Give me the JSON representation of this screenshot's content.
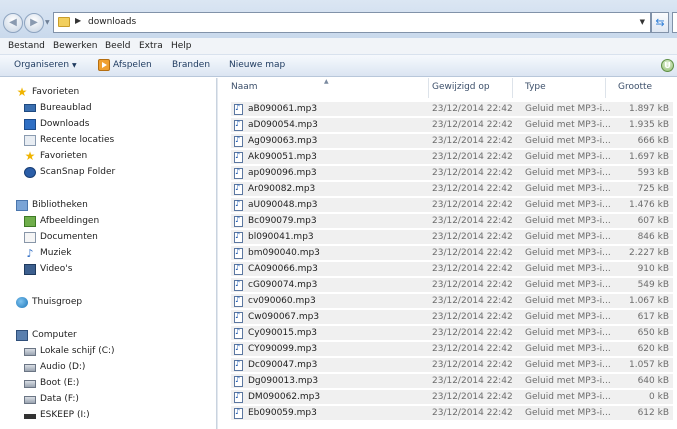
{
  "address": {
    "path": "downloads"
  },
  "menu": [
    "Bestand",
    "Bewerken",
    "Beeld",
    "Extra",
    "Help"
  ],
  "commands": {
    "organize": "Organiseren",
    "play": "Afspelen",
    "burn": "Branden",
    "new_folder": "Nieuwe map"
  },
  "nav": {
    "favorites_header": "Favorieten",
    "favorites": [
      "Bureaublad",
      "Downloads",
      "Recente locaties",
      "Favorieten",
      "ScanSnap Folder"
    ],
    "libraries_header": "Bibliotheken",
    "libraries": [
      "Afbeeldingen",
      "Documenten",
      "Muziek",
      "Video's"
    ],
    "homegroup": "Thuisgroep",
    "computer_header": "Computer",
    "drives": [
      "Lokale schijf (C:)",
      "Audio (D:)",
      "Boot (E:)",
      "Data (F:)",
      "ESKEEP (I:)"
    ]
  },
  "columns": {
    "name": "Naam",
    "modified": "Gewijzigd op",
    "type": "Type",
    "size": "Grootte"
  },
  "files": [
    {
      "name": "aB090061.mp3",
      "date": "23/12/2014 22:42",
      "type": "Geluid met MP3-i...",
      "size": "1.897 kB"
    },
    {
      "name": "aD090054.mp3",
      "date": "23/12/2014 22:42",
      "type": "Geluid met MP3-i...",
      "size": "1.935 kB"
    },
    {
      "name": "Ag090063.mp3",
      "date": "23/12/2014 22:42",
      "type": "Geluid met MP3-i...",
      "size": "666 kB"
    },
    {
      "name": "Ak090051.mp3",
      "date": "23/12/2014 22:42",
      "type": "Geluid met MP3-i...",
      "size": "1.697 kB"
    },
    {
      "name": "ap090096.mp3",
      "date": "23/12/2014 22:42",
      "type": "Geluid met MP3-i...",
      "size": "593 kB"
    },
    {
      "name": "Ar090082.mp3",
      "date": "23/12/2014 22:42",
      "type": "Geluid met MP3-i...",
      "size": "725 kB"
    },
    {
      "name": "aU090048.mp3",
      "date": "23/12/2014 22:42",
      "type": "Geluid met MP3-i...",
      "size": "1.476 kB"
    },
    {
      "name": "Bc090079.mp3",
      "date": "23/12/2014 22:42",
      "type": "Geluid met MP3-i...",
      "size": "607 kB"
    },
    {
      "name": "bl090041.mp3",
      "date": "23/12/2014 22:42",
      "type": "Geluid met MP3-i...",
      "size": "846 kB"
    },
    {
      "name": "bm090040.mp3",
      "date": "23/12/2014 22:42",
      "type": "Geluid met MP3-i...",
      "size": "2.227 kB"
    },
    {
      "name": "CA090066.mp3",
      "date": "23/12/2014 22:42",
      "type": "Geluid met MP3-i...",
      "size": "910 kB"
    },
    {
      "name": "cG090074.mp3",
      "date": "23/12/2014 22:42",
      "type": "Geluid met MP3-i...",
      "size": "549 kB"
    },
    {
      "name": "cv090060.mp3",
      "date": "23/12/2014 22:42",
      "type": "Geluid met MP3-i...",
      "size": "1.067 kB"
    },
    {
      "name": "Cw090067.mp3",
      "date": "23/12/2014 22:42",
      "type": "Geluid met MP3-i...",
      "size": "617 kB"
    },
    {
      "name": "Cy090015.mp3",
      "date": "23/12/2014 22:42",
      "type": "Geluid met MP3-i...",
      "size": "650 kB"
    },
    {
      "name": "CY090099.mp3",
      "date": "23/12/2014 22:42",
      "type": "Geluid met MP3-i...",
      "size": "620 kB"
    },
    {
      "name": "Dc090047.mp3",
      "date": "23/12/2014 22:42",
      "type": "Geluid met MP3-i...",
      "size": "1.057 kB"
    },
    {
      "name": "Dg090013.mp3",
      "date": "23/12/2014 22:42",
      "type": "Geluid met MP3-i...",
      "size": "640 kB"
    },
    {
      "name": "DM090062.mp3",
      "date": "23/12/2014 22:42",
      "type": "Geluid met MP3-i...",
      "size": "0 kB"
    },
    {
      "name": "Eb090059.mp3",
      "date": "23/12/2014 22:42",
      "type": "Geluid met MP3-i...",
      "size": "612 kB"
    }
  ]
}
